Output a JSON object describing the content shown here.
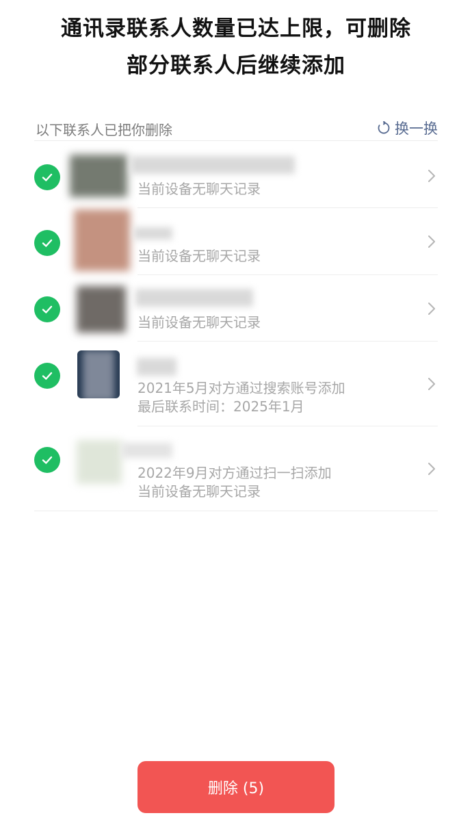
{
  "header": {
    "title_line1": "通讯录联系人数量已达上限，可删除",
    "title_line2": "部分联系人后继续添加"
  },
  "section": {
    "title": "以下联系人已把你删除",
    "refresh_label": "换一换"
  },
  "contacts": [
    {
      "selected": true,
      "line1": "当前设备无聊天记录",
      "line2": ""
    },
    {
      "selected": true,
      "line1": "当前设备无聊天记录",
      "line2": ""
    },
    {
      "selected": true,
      "line1": "当前设备无聊天记录",
      "line2": ""
    },
    {
      "selected": true,
      "line1": "2021年5月对方通过搜索账号添加",
      "line2": "最后联系时间：2025年1月"
    },
    {
      "selected": true,
      "line1": "2022年9月对方通过扫一扫添加",
      "line2": "当前设备无聊天记录"
    }
  ],
  "footer": {
    "delete_label": "删除 (5)"
  },
  "colors": {
    "accent_green": "#1fbe63",
    "delete_red": "#f25553",
    "link_blue": "#586b91"
  }
}
